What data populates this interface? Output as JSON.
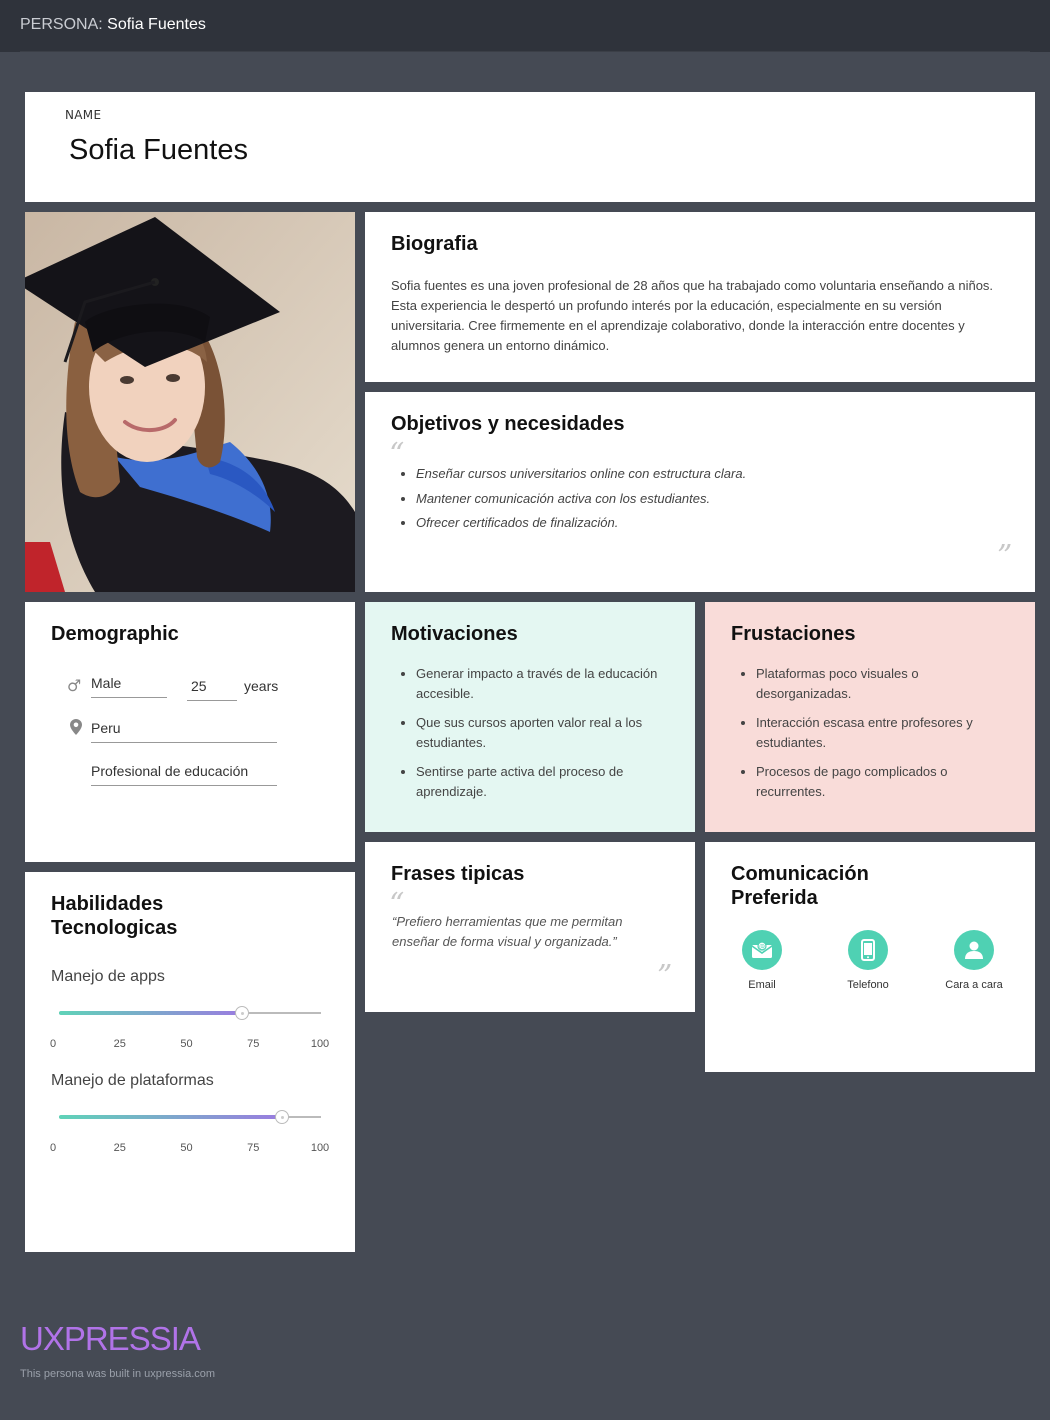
{
  "header": {
    "prefix": "PERSONA:",
    "name": "Sofia Fuentes"
  },
  "name_card": {
    "label": "NAME",
    "value": "Sofia Fuentes"
  },
  "biography": {
    "title": "Biografia",
    "text": "Sofia fuentes es una joven profesional de 28 años que ha trabajado como voluntaria enseñando a niños. Esta experiencia le despertó un profundo interés por la educación, especialmente en su versión universitaria. Cree firmemente en el aprendizaje colaborativo, donde la interacción entre docentes y alumnos genera un entorno dinámico."
  },
  "goals": {
    "title": "Objetivos y necesidades",
    "items": [
      "Enseñar cursos universitarios online con estructura clara.",
      "Mantener comunicación activa con los estudiantes.",
      "Ofrecer certificados de finalización."
    ]
  },
  "demographic": {
    "title": "Demographic",
    "gender": "Male",
    "age": "25",
    "age_unit": "years",
    "location": "Peru",
    "occupation": "Profesional de educación"
  },
  "motivations": {
    "title": "Motivaciones",
    "items": [
      "Generar impacto a través de la educación accesible.",
      "Que sus cursos aporten valor real a los estudiantes.",
      "Sentirse parte activa del proceso de aprendizaje."
    ]
  },
  "frustrations": {
    "title": "Frustaciones",
    "items": [
      "Plataformas poco visuales o desorganizadas.",
      "Interacción escasa entre profesores y estudiantes.",
      "Procesos de pago complicados o recurrentes."
    ]
  },
  "skills": {
    "title": "Habilidades Tecnologicas",
    "items": [
      {
        "name": "Manejo de apps",
        "value": 70
      },
      {
        "name": "Manejo de plataformas",
        "value": 85
      }
    ],
    "ticks": [
      "0",
      "25",
      "50",
      "75",
      "100"
    ]
  },
  "quotes": {
    "title": "Frases tipicas",
    "text": "“Prefiero herramientas que me permitan enseñar de forma visual y organizada.”"
  },
  "communication": {
    "title": "Comunicación Preferida",
    "channels": [
      {
        "label": "Email",
        "icon": "email-icon"
      },
      {
        "label": "Telefono",
        "icon": "phone-icon"
      },
      {
        "label": "Cara a cara",
        "icon": "person-icon"
      }
    ],
    "accent": "#4fd1b3"
  },
  "footer": {
    "brand": "UXPRESSIA",
    "note": "This persona was built in uxpressia.com"
  }
}
